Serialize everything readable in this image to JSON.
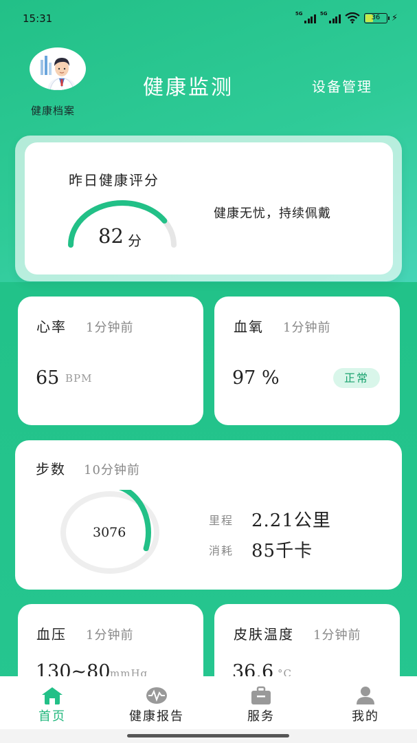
{
  "status_bar": {
    "time": "15:31",
    "signal_1": "5G",
    "signal_2": "5G",
    "battery": "36"
  },
  "header": {
    "avatar_label": "健康档案",
    "title": "健康监测",
    "device_button": "设备管理"
  },
  "score": {
    "title": "昨日健康评分",
    "value": "82",
    "unit": "分",
    "progress_fraction": 0.82,
    "message": "健康无忧，持续佩戴"
  },
  "heart_rate": {
    "title": "心率",
    "time": "1分钟前",
    "value": "65",
    "unit": "BPM"
  },
  "blood_oxygen": {
    "title": "血氧",
    "time": "1分钟前",
    "value": "97 %",
    "badge": "正常"
  },
  "steps": {
    "title": "步数",
    "time": "10分钟前",
    "value": "3076",
    "ring_progress_fraction": 0.31,
    "distance_label": "里程",
    "distance_value": "2.21公里",
    "calories_label": "消耗",
    "calories_value": "85千卡"
  },
  "blood_pressure": {
    "title": "血压",
    "time": "1分钟前",
    "value": "130~80",
    "unit": "mmHg"
  },
  "skin_temperature": {
    "title": "皮肤温度",
    "time": "1分钟前",
    "value": "36.6",
    "unit": "°C"
  },
  "nav": {
    "items": [
      {
        "label": "首页",
        "icon": "home-icon",
        "active": true
      },
      {
        "label": "健康报告",
        "icon": "health-report-icon",
        "active": false
      },
      {
        "label": "服务",
        "icon": "service-icon",
        "active": false
      },
      {
        "label": "我的",
        "icon": "profile-icon",
        "active": false
      }
    ]
  },
  "colors": {
    "accent": "#22c087",
    "gauge_track": "#e6e6e6",
    "badge_bg": "#d9f6ea",
    "badge_text": "#19a26e"
  }
}
